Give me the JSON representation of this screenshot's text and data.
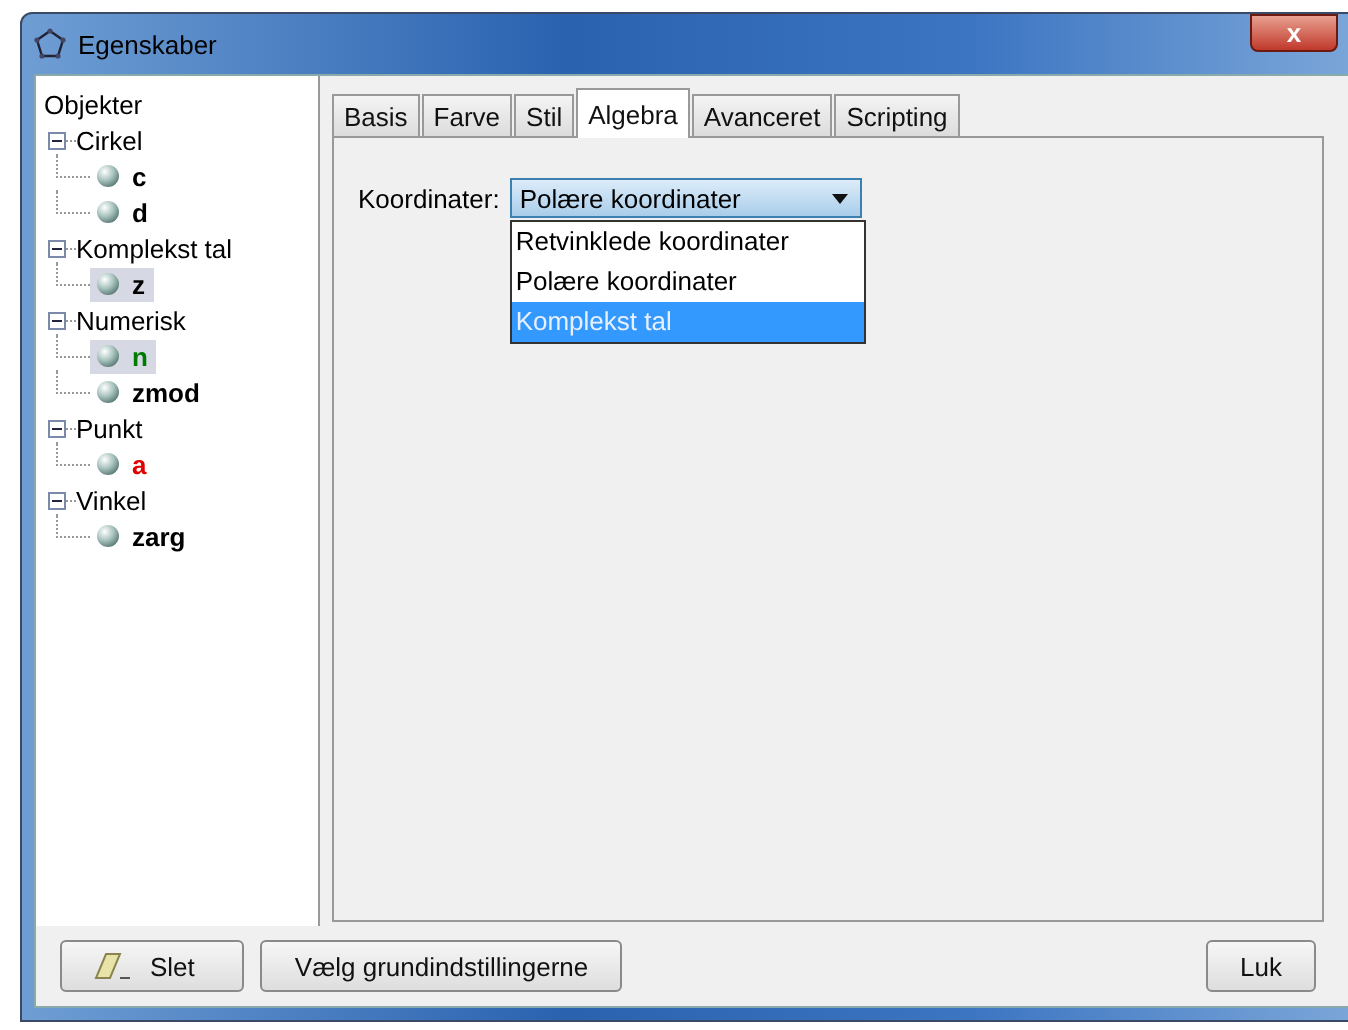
{
  "window": {
    "title": "Egenskaber",
    "close": "x"
  },
  "tree": {
    "root": "Objekter",
    "groups": [
      {
        "label": "Cirkel",
        "expanded": true,
        "children": [
          {
            "label": "c",
            "color": "#000000",
            "selected": false
          },
          {
            "label": "d",
            "color": "#000000",
            "selected": false
          }
        ]
      },
      {
        "label": "Komplekst tal",
        "expanded": true,
        "children": [
          {
            "label": "z",
            "color": "#000000",
            "selected": true
          }
        ]
      },
      {
        "label": "Numerisk",
        "expanded": true,
        "children": [
          {
            "label": "n",
            "color": "#007a00",
            "selected": true
          },
          {
            "label": "zmod",
            "color": "#000000",
            "selected": false
          }
        ]
      },
      {
        "label": "Punkt",
        "expanded": true,
        "children": [
          {
            "label": "a",
            "color": "#e00000",
            "selected": false
          }
        ]
      },
      {
        "label": "Vinkel",
        "expanded": true,
        "children": [
          {
            "label": "zarg",
            "color": "#000000",
            "selected": false
          }
        ]
      }
    ]
  },
  "tabs": [
    {
      "label": "Basis",
      "selected": false
    },
    {
      "label": "Farve",
      "selected": false
    },
    {
      "label": "Stil",
      "selected": false
    },
    {
      "label": "Algebra",
      "selected": true
    },
    {
      "label": "Avanceret",
      "selected": false
    },
    {
      "label": "Scripting",
      "selected": false
    }
  ],
  "coordinates": {
    "label": "Koordinater:",
    "value": "Polære koordinater",
    "expanded": true,
    "options": [
      {
        "label": "Retvinklede koordinater",
        "highlighted": false
      },
      {
        "label": "Polære koordinater",
        "highlighted": false
      },
      {
        "label": "Komplekst tal",
        "highlighted": true
      }
    ]
  },
  "buttons": [
    {
      "label": "Slet",
      "kind": "delete"
    },
    {
      "label": "Vælg grundindstillingerne",
      "kind": "plain"
    },
    {
      "label": "Luk",
      "kind": "close"
    }
  ]
}
